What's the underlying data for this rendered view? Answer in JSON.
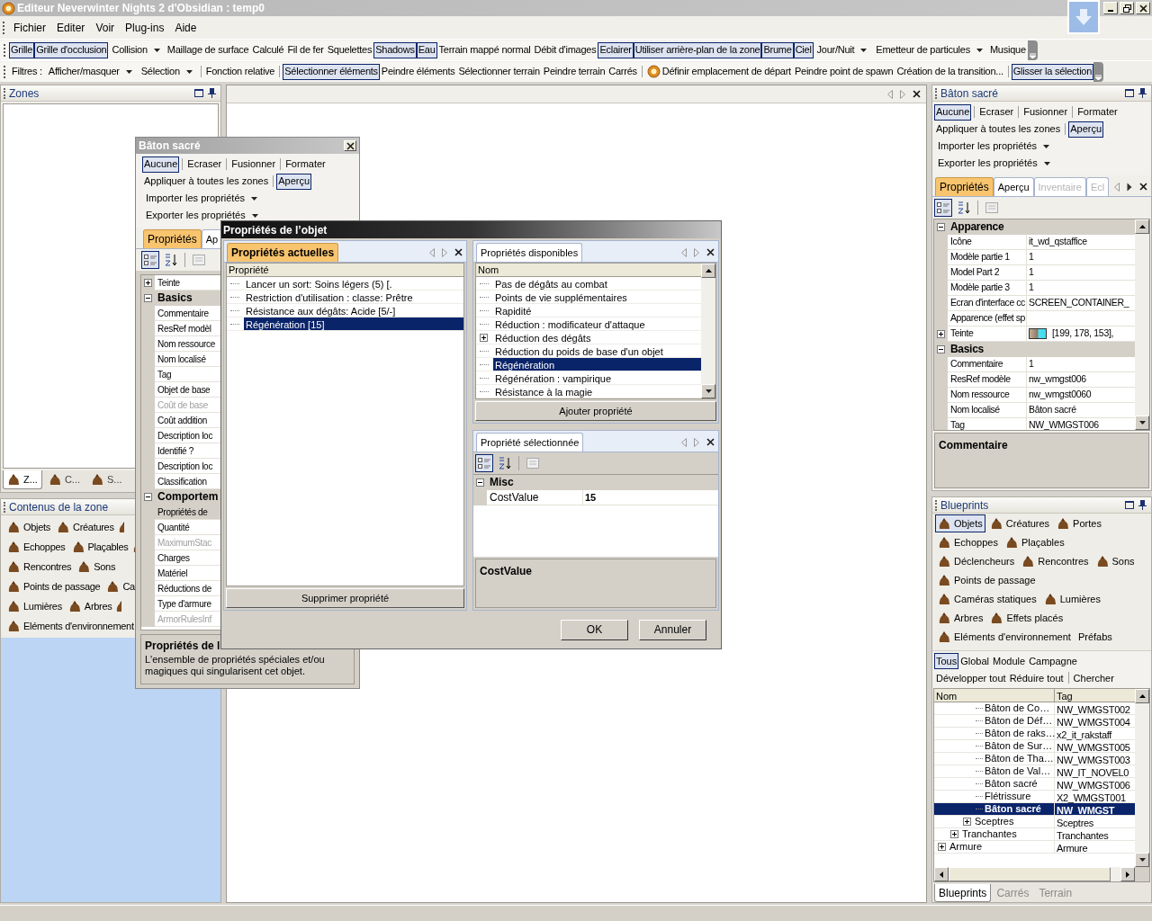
{
  "window": {
    "title": "Editeur Neverwinter Nights 2 d'Obsidian : temp0"
  },
  "menu": [
    "Fichier",
    "Editer",
    "Voir",
    "Plug-ins",
    "Aide"
  ],
  "view_toolbar": [
    {
      "label": "Grille",
      "kind": "toggle",
      "on": true
    },
    {
      "label": "Grille d'occlusion",
      "kind": "toggle",
      "on": true
    },
    {
      "label": "Collision",
      "kind": "dropdown"
    },
    {
      "label": "Maillage de surface",
      "kind": "toggle",
      "on": false
    },
    {
      "label": "Calculé",
      "kind": "toggle",
      "on": false
    },
    {
      "label": "Fil de fer",
      "kind": "toggle",
      "on": false
    },
    {
      "label": "Squelettes",
      "kind": "toggle",
      "on": false
    },
    {
      "label": "Shadows",
      "kind": "toggle",
      "on": true
    },
    {
      "label": "Eau",
      "kind": "toggle",
      "on": true
    },
    {
      "label": "Terrain mappé normal",
      "kind": "toggle",
      "on": false
    },
    {
      "label": "Débit d'images",
      "kind": "toggle",
      "on": false
    },
    {
      "label": "Eclairer",
      "kind": "toggle",
      "on": true
    },
    {
      "label": "Utiliser arrière-plan de la zone",
      "kind": "toggle",
      "on": true
    },
    {
      "label": "Brume",
      "kind": "toggle",
      "on": true
    },
    {
      "label": "Ciel",
      "kind": "toggle",
      "on": true
    },
    {
      "label": "Jour/Nuit",
      "kind": "dropdown"
    },
    {
      "label": "Emetteur de particules",
      "kind": "dropdown"
    },
    {
      "label": "Musique",
      "kind": "toggle",
      "on": false
    }
  ],
  "filter_toolbar": [
    {
      "label": "Filtres :",
      "kind": "label"
    },
    {
      "label": "Afficher/masquer",
      "kind": "dropdown"
    },
    {
      "label": "Sélection",
      "kind": "dropdown"
    },
    {
      "label": "Fonction relative",
      "kind": "toggle",
      "on": false,
      "separator_before": true
    },
    {
      "label": "Sélectionner éléments",
      "kind": "toggle",
      "on": true,
      "separator_before": true
    },
    {
      "label": "Peindre éléments",
      "kind": "toggle",
      "on": false
    },
    {
      "label": "Sélectionner terrain",
      "kind": "toggle",
      "on": false
    },
    {
      "label": "Peindre terrain",
      "kind": "toggle",
      "on": false
    },
    {
      "label": "Carrés",
      "kind": "toggle",
      "on": false
    },
    {
      "label": "Définir emplacement de départ",
      "kind": "toggle",
      "on": false,
      "separator_before": true,
      "icon": true
    },
    {
      "label": "Peindre point de spawn",
      "kind": "toggle",
      "on": false
    },
    {
      "label": "Création de la transition...",
      "kind": "toggle",
      "on": false
    },
    {
      "label": "Glisser la sélection",
      "kind": "toggle",
      "on": true,
      "separator_before": true
    }
  ],
  "zones_panel": {
    "title": "Zones",
    "tabs": [
      {
        "label": "Z...",
        "selected": true
      },
      {
        "label": "C...",
        "selected": false
      },
      {
        "label": "S...",
        "selected": false
      }
    ]
  },
  "zone_contents": {
    "title": "Contenus de la zone",
    "rows": [
      [
        {
          "kind": "entry",
          "label": "Objets"
        },
        {
          "kind": "entry",
          "label": "Créatures"
        },
        {
          "kind": "icon"
        }
      ],
      [
        {
          "kind": "entry",
          "label": "Echoppes"
        },
        {
          "kind": "entry",
          "label": "Plaçables"
        },
        {
          "kind": "icon"
        }
      ],
      [
        {
          "kind": "entry",
          "label": "Rencontres"
        },
        {
          "kind": "entry",
          "label": "Sons"
        }
      ],
      [
        {
          "kind": "entry",
          "label": "Points de passage"
        },
        {
          "kind": "entry",
          "label": "Ca"
        }
      ],
      [
        {
          "kind": "entry",
          "label": "Lumières"
        },
        {
          "kind": "entry",
          "label": "Arbres"
        },
        {
          "kind": "icon"
        }
      ],
      [
        {
          "kind": "entry",
          "label": "Eléments d'environnement"
        }
      ]
    ]
  },
  "floating_window": {
    "title": "Bâton sacré",
    "toolbar_rows": [
      [
        {
          "label": "Aucune",
          "kind": "toggle",
          "on": true
        },
        {
          "label": "Ecraser",
          "kind": "toggle",
          "on": false,
          "separator_before": true
        },
        {
          "label": "Fusionner",
          "kind": "toggle",
          "on": false,
          "separator_before": true
        },
        {
          "label": "Formater",
          "kind": "toggle",
          "on": false,
          "separator_before": true
        }
      ],
      [
        {
          "label": "Appliquer à toutes les zones",
          "kind": "toggle",
          "on": false
        },
        {
          "label": "Aperçu",
          "kind": "toggle",
          "on": true,
          "separator_before": true
        }
      ],
      [
        {
          "label": "Importer les propriétés",
          "kind": "dropdown"
        }
      ],
      [
        {
          "label": "Exporter les propriétés",
          "kind": "dropdown"
        }
      ]
    ],
    "tabs": [
      {
        "label": "Propriétés",
        "selected": true,
        "disabled": false
      },
      {
        "label": "Ap",
        "selected": false,
        "disabled": false
      }
    ],
    "grid": [
      {
        "kind": "property",
        "label": "Teinte",
        "expanded": false,
        "disabled": false,
        "selected": false
      },
      {
        "kind": "category",
        "label": "Basics",
        "expanded": true
      },
      {
        "kind": "property",
        "label": "Commentaire",
        "disabled": false,
        "selected": false
      },
      {
        "kind": "property",
        "label": "ResRef modèl",
        "disabled": false,
        "selected": false
      },
      {
        "kind": "property",
        "label": "Nom ressource",
        "disabled": false,
        "selected": false
      },
      {
        "kind": "property",
        "label": "Nom localisé",
        "disabled": false,
        "selected": false
      },
      {
        "kind": "property",
        "label": "Tag",
        "disabled": false,
        "selected": false
      },
      {
        "kind": "property",
        "label": "Objet de base",
        "disabled": false,
        "selected": false
      },
      {
        "kind": "property",
        "label": "Coût de base",
        "disabled": true,
        "selected": false
      },
      {
        "kind": "property",
        "label": "Coût addition",
        "disabled": false,
        "selected": false
      },
      {
        "kind": "property",
        "label": "Description loc",
        "disabled": false,
        "selected": false
      },
      {
        "kind": "property",
        "label": "Identifié ?",
        "disabled": false,
        "selected": false
      },
      {
        "kind": "property",
        "label": "Description loc",
        "disabled": false,
        "selected": false
      },
      {
        "kind": "property",
        "label": "Classification",
        "disabled": false,
        "selected": false
      },
      {
        "kind": "category",
        "label": "Comportem",
        "expanded": true
      },
      {
        "kind": "property",
        "label": "Propriétés de",
        "disabled": false,
        "selected": true
      },
      {
        "kind": "property",
        "label": "Quantité",
        "disabled": false,
        "selected": false
      },
      {
        "kind": "property",
        "label": "MaximumStac",
        "disabled": true,
        "selected": false
      },
      {
        "kind": "property",
        "label": "Charges",
        "disabled": false,
        "selected": false
      },
      {
        "kind": "property",
        "label": "Matériel",
        "disabled": false,
        "selected": false
      },
      {
        "kind": "property",
        "label": "Réductions de",
        "disabled": false,
        "selected": false
      },
      {
        "kind": "property",
        "label": "Type d'armure",
        "disabled": false,
        "selected": false
      },
      {
        "kind": "property",
        "label": "ArmorRulesInf",
        "disabled": true,
        "selected": false
      }
    ],
    "description": {
      "title": "Propriétés de l",
      "text": "L'ensemble de propriétés spéciales et/ou magiques qui singularisent cet objet."
    }
  },
  "dialog": {
    "title": "Propriétés de l’objet",
    "current": {
      "tab": {
        "label": "Propriétés actuelles",
        "selected": true
      },
      "column": "Propriété",
      "items": [
        {
          "label": "Lancer un sort: Soins légers (5) [.",
          "selected": false
        },
        {
          "label": "Restriction d'utilisation : classe: Prêtre",
          "selected": false
        },
        {
          "label": "Résistance aux dégâts: Acide [5/-]",
          "selected": false
        },
        {
          "label": "Régénération [15]",
          "selected": true
        }
      ],
      "button": "Supprimer propriété"
    },
    "available": {
      "tab": {
        "label": "Propriétés disponibles",
        "selected": false
      },
      "column": "Nom",
      "items": [
        {
          "label": "Pas de dégâts au combat",
          "selected": false
        },
        {
          "label": "Points de vie supplémentaires",
          "selected": false
        },
        {
          "label": "Rapidité",
          "selected": false
        },
        {
          "label": "Réduction : modificateur d'attaque",
          "selected": false
        },
        {
          "label": "Réduction des dégâts",
          "selected": false,
          "expanded": false
        },
        {
          "label": "Réduction du poids de base d'un objet",
          "selected": false
        },
        {
          "label": "Régénération",
          "selected": true
        },
        {
          "label": "Régénération : vampirique",
          "selected": false
        },
        {
          "label": "Résistance à la magie",
          "selected": false
        }
      ],
      "button": "Ajouter propriété"
    },
    "selected_property": {
      "tab": {
        "label": "Propriété sélectionnée",
        "selected": false
      },
      "grid": [
        {
          "kind": "category",
          "label": "Misc",
          "expanded": true
        },
        {
          "kind": "property",
          "label": "CostValue",
          "value": "15",
          "disabled": false,
          "modified": true
        }
      ],
      "description": {
        "title": "CostValue"
      }
    },
    "buttons": [
      "OK",
      "Annuler"
    ]
  },
  "properties_panel": {
    "title": "Bâton sacré",
    "toolbar_rows": [
      [
        {
          "label": "Aucune",
          "kind": "toggle",
          "on": true
        },
        {
          "label": "Ecraser",
          "kind": "toggle",
          "on": false,
          "separator_before": true
        },
        {
          "label": "Fusionner",
          "kind": "toggle",
          "on": false,
          "separator_before": true
        },
        {
          "label": "Formater",
          "kind": "toggle",
          "on": false,
          "separator_before": true
        }
      ],
      [
        {
          "label": "Appliquer à toutes les zones",
          "kind": "toggle",
          "on": false
        },
        {
          "label": "Aperçu",
          "kind": "toggle",
          "on": true,
          "separator_before": true
        }
      ],
      [
        {
          "label": "Importer les propriétés",
          "kind": "dropdown"
        }
      ],
      [
        {
          "label": "Exporter les propriétés",
          "kind": "dropdown"
        }
      ]
    ],
    "tabs": [
      {
        "label": "Propriétés",
        "selected": true,
        "disabled": false
      },
      {
        "label": "Aperçu",
        "selected": false,
        "disabled": false
      },
      {
        "label": "Inventaire",
        "selected": false,
        "disabled": true
      },
      {
        "label": "Ecl",
        "selected": false,
        "disabled": true
      }
    ],
    "grid": [
      {
        "kind": "category",
        "label": "Apparence",
        "expanded": true
      },
      {
        "kind": "property",
        "label": "Icône",
        "value": "it_wd_qstaffice",
        "disabled": false
      },
      {
        "kind": "property",
        "label": "Modèle partie 1",
        "value": "1",
        "disabled": false
      },
      {
        "kind": "property",
        "label": "Model Part 2",
        "value": "1",
        "disabled": false
      },
      {
        "kind": "property",
        "label": "Modèle partie 3",
        "value": "1",
        "disabled": false
      },
      {
        "kind": "property",
        "label": "Ecran d'interface cc",
        "value": "SCREEN_CONTAINER_",
        "disabled": false
      },
      {
        "kind": "property",
        "label": "Apparence (effet sp",
        "disabled": false
      },
      {
        "kind": "color",
        "label": "Teinte",
        "value": "[199, 178, 153],",
        "expanded": false,
        "disabled": false
      },
      {
        "kind": "category",
        "label": "Basics",
        "expanded": true
      },
      {
        "kind": "property",
        "label": "Commentaire",
        "value": "1",
        "disabled": false
      },
      {
        "kind": "property",
        "label": "ResRef modèle",
        "value": "nw_wmgst006",
        "disabled": false
      },
      {
        "kind": "property",
        "label": "Nom ressource",
        "value": "nw_wmgst0060",
        "disabled": false
      },
      {
        "kind": "property",
        "label": "Nom localisé",
        "value": "Bâton sacré",
        "disabled": false
      },
      {
        "kind": "property",
        "label": "Tag",
        "value": "NW_WMGST006",
        "disabled": false
      }
    ],
    "description": {
      "title": "Commentaire"
    }
  },
  "blueprints": {
    "title": "Blueprints",
    "palette": [
      [
        {
          "kind": "entry",
          "label": "Objets",
          "selected": true
        },
        {
          "kind": "entry",
          "label": "Créatures",
          "selected": false
        },
        {
          "kind": "entry",
          "label": "Portes",
          "selected": false
        }
      ],
      [
        {
          "kind": "entry",
          "label": "Echoppes",
          "selected": false
        },
        {
          "kind": "entry",
          "label": "Plaçables",
          "selected": false
        }
      ],
      [
        {
          "kind": "entry",
          "label": "Déclencheurs",
          "selected": false
        },
        {
          "kind": "entry",
          "label": "Rencontres",
          "selected": false
        },
        {
          "kind": "entry",
          "label": "Sons",
          "selected": false
        }
      ],
      [
        {
          "kind": "entry",
          "label": "Points de passage",
          "selected": false
        }
      ],
      [
        {
          "kind": "entry",
          "label": "Caméras statiques",
          "selected": false
        },
        {
          "kind": "entry",
          "label": "Lumières",
          "selected": false
        }
      ],
      [
        {
          "kind": "entry",
          "label": "Arbres",
          "selected": false
        },
        {
          "kind": "entry",
          "label": "Effets placés",
          "selected": false
        }
      ],
      [
        {
          "kind": "entry",
          "label": "Eléments d'environnement",
          "selected": false
        },
        {
          "kind": "text",
          "label": "Préfabs",
          "selected": false
        }
      ]
    ],
    "filters": [
      [
        {
          "label": "Tous",
          "kind": "toggle",
          "on": true
        },
        {
          "label": "Global",
          "kind": "toggle",
          "on": false
        },
        {
          "label": "Module",
          "kind": "toggle",
          "on": false
        },
        {
          "label": "Campagne",
          "kind": "toggle",
          "on": false
        }
      ],
      [
        {
          "label": "Développer tout",
          "kind": "toggle",
          "on": false
        },
        {
          "label": "Réduire tout",
          "kind": "toggle",
          "on": false
        },
        {
          "label": "Chercher",
          "kind": "toggle",
          "on": false,
          "separator_before": true
        }
      ]
    ],
    "columns": [
      "Nom",
      "Tag"
    ],
    "tree": [
      {
        "children": [
          {
            "children": [
              {
                "children": [
                  {
                    "name": "Bâton de Co…",
                    "tag": "NW_WMGST002",
                    "selected": false
                  },
                  {
                    "name": "Bâton de Déf…",
                    "tag": "NW_WMGST004",
                    "selected": false
                  },
                  {
                    "name": "Bâton de raks…",
                    "tag": "x2_it_rakstaff",
                    "selected": false
                  },
                  {
                    "name": "Bâton de Sur…",
                    "tag": "NW_WMGST005",
                    "selected": false
                  },
                  {
                    "name": "Bâton de Tha…",
                    "tag": "NW_WMGST003",
                    "selected": false
                  },
                  {
                    "name": "Bâton de Val…",
                    "tag": "NW_IT_NOVEL0",
                    "selected": false
                  },
                  {
                    "name": "Bâton sacré",
                    "tag": "NW_WMGST006",
                    "selected": false
                  },
                  {
                    "name": "Flétrissure",
                    "tag": "X2_WMGST001",
                    "selected": false
                  },
                  {
                    "name": "Bâton sacré",
                    "tag": "NW_WMGST",
                    "selected": true
                  }
                ]
              },
              {
                "name": "Sceptres",
                "tag": "Sceptres",
                "expanded": false,
                "selected": false
              }
            ]
          },
          {
            "name": "Tranchantes",
            "tag": "Tranchantes",
            "expanded": false,
            "selected": false
          }
        ]
      },
      {
        "name": "Armure",
        "tag": "Armure",
        "expanded": false,
        "selected": false
      }
    ],
    "tabs": [
      {
        "label": "Blueprints",
        "selected": true
      },
      {
        "label": "Carrés",
        "selected": false
      },
      {
        "label": "Terrain",
        "selected": false
      }
    ]
  }
}
